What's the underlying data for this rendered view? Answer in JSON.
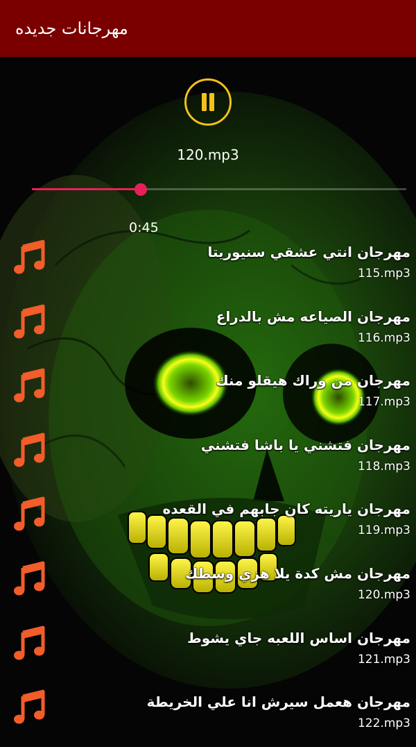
{
  "app_bar": {
    "title": "مهرجانات جديده",
    "color": "#7a0000"
  },
  "player": {
    "state": "playing",
    "button_icon": "pause-icon",
    "button_color": "#f2c21b",
    "current_file": "120.mp3",
    "elapsed": "0:45",
    "progress": 0.29,
    "seek_color": "#e8205a"
  },
  "tracks": [
    {
      "title": "مهرجان انتي عشقي سنيوريتا",
      "file": "115.mp3",
      "icon": "music-note-icon"
    },
    {
      "title": "مهرجان الصياعه مش بالدراع",
      "file": "116.mp3",
      "icon": "music-note-icon"
    },
    {
      "title": "مهرجان من وراك هيقلو منك",
      "file": "117.mp3",
      "icon": "music-note-icon"
    },
    {
      "title": "مهرجان فتشني يا باشا فتشني",
      "file": "118.mp3",
      "icon": "music-note-icon"
    },
    {
      "title": "مهرجان ياريته كان جابهم في القعده",
      "file": "119.mp3",
      "icon": "music-note-icon"
    },
    {
      "title": "مهرجان مش كدة يلا هزي وسطك",
      "file": "120.mp3",
      "icon": "music-note-icon"
    },
    {
      "title": "مهرجان اساس اللعبه جاي يشوط",
      "file": "121.mp3",
      "icon": "music-note-icon"
    },
    {
      "title": "مهرجان هعمل سيرش انا علي الخريطة",
      "file": "122.mp3",
      "icon": "music-note-icon"
    }
  ],
  "note_icon_color": "#f25d2a"
}
